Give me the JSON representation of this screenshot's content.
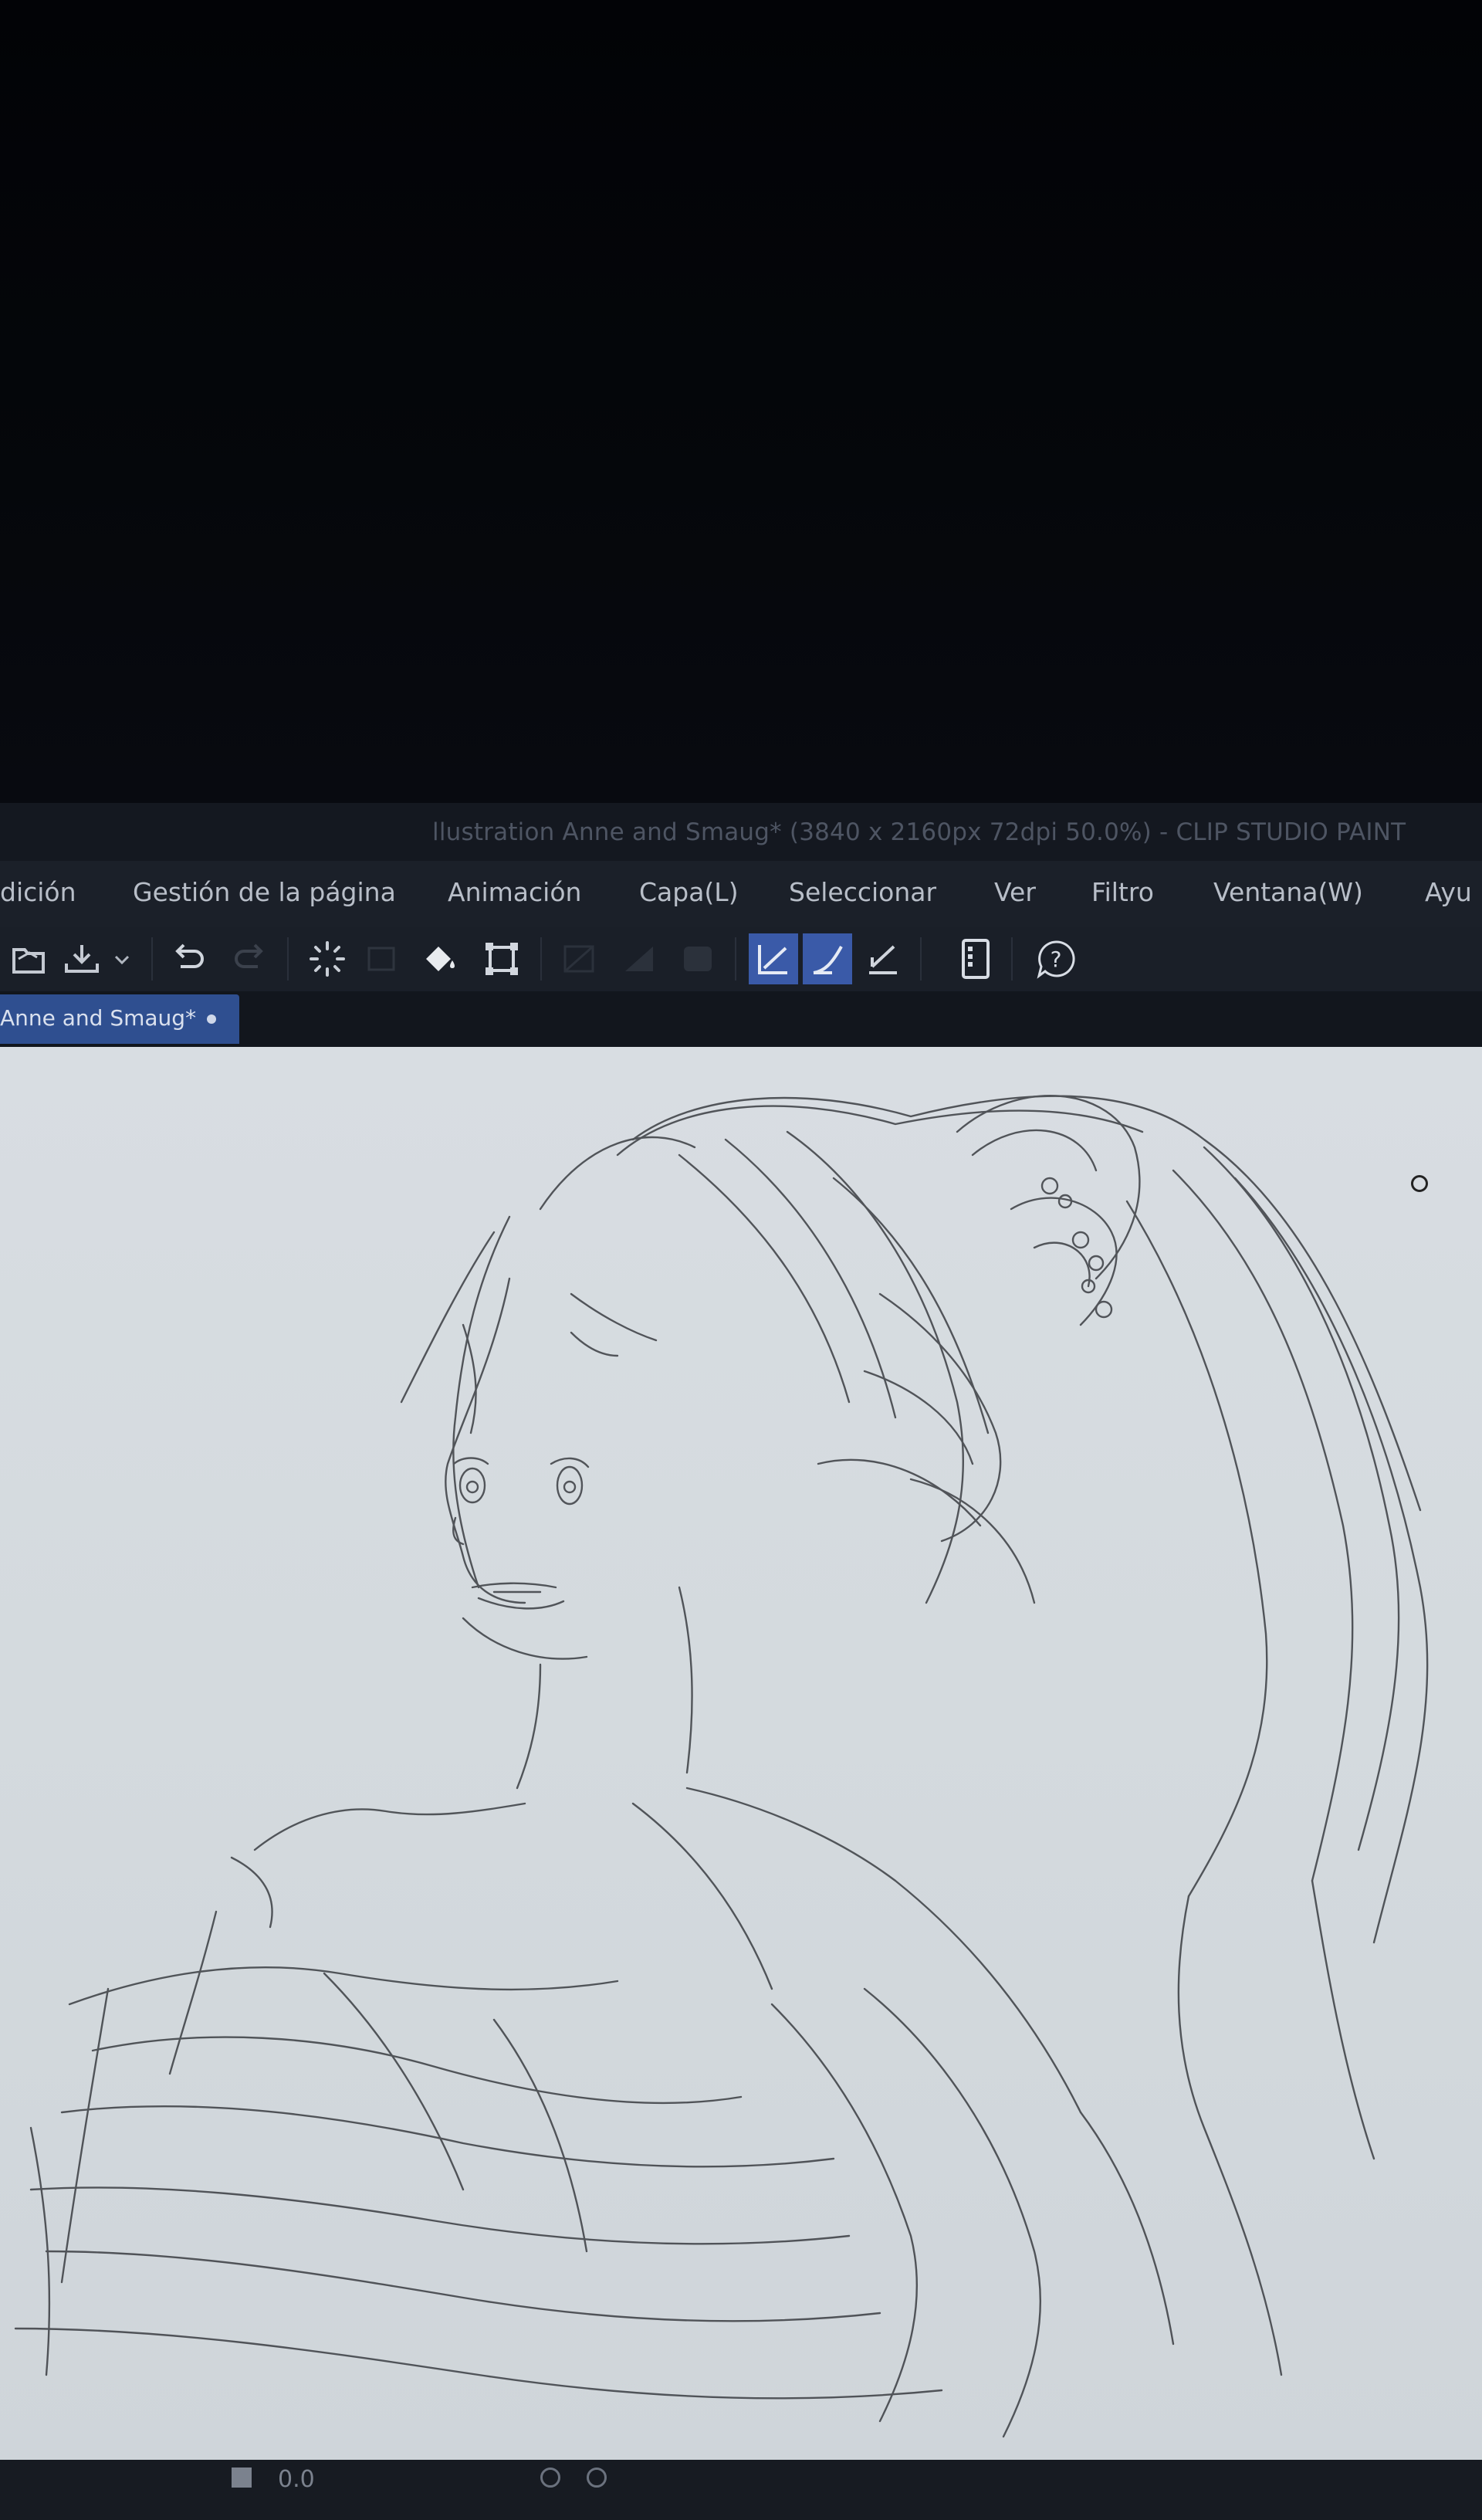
{
  "window": {
    "title": "llustration Anne and Smaug* (3840 x 2160px 72dpi 50.0%) - CLIP STUDIO PAINT"
  },
  "menu": {
    "items": [
      {
        "label": "dición"
      },
      {
        "label": "Gestión de la página"
      },
      {
        "label": "Animación"
      },
      {
        "label": "Capa(L)"
      },
      {
        "label": "Seleccionar"
      },
      {
        "label": "Ver"
      },
      {
        "label": "Filtro"
      },
      {
        "label": "Ventana(W)"
      },
      {
        "label": "Ayu"
      }
    ]
  },
  "toolbar": {
    "icons": [
      "open-file-icon",
      "save-icon",
      "dropdown-chevron-icon",
      "undo-icon",
      "redo-icon",
      "loading-spinner-icon",
      "fill-bucket-icon",
      "transform-icon",
      "clear-layer-icon",
      "fill-selection-icon",
      "invert-icon",
      "pen-pressure-icon",
      "pen-stroke-icon",
      "pen-correction-icon",
      "tablet-icon",
      "help-icon"
    ]
  },
  "tabs": {
    "document": {
      "label": "Anne and Smaug*"
    }
  },
  "status": {
    "zoom": "0.0"
  },
  "colors": {
    "accent": "#3a5aa8",
    "tab_active": "#2f4f90",
    "canvas": "#d6dbe0",
    "chrome": "#1b2029"
  }
}
